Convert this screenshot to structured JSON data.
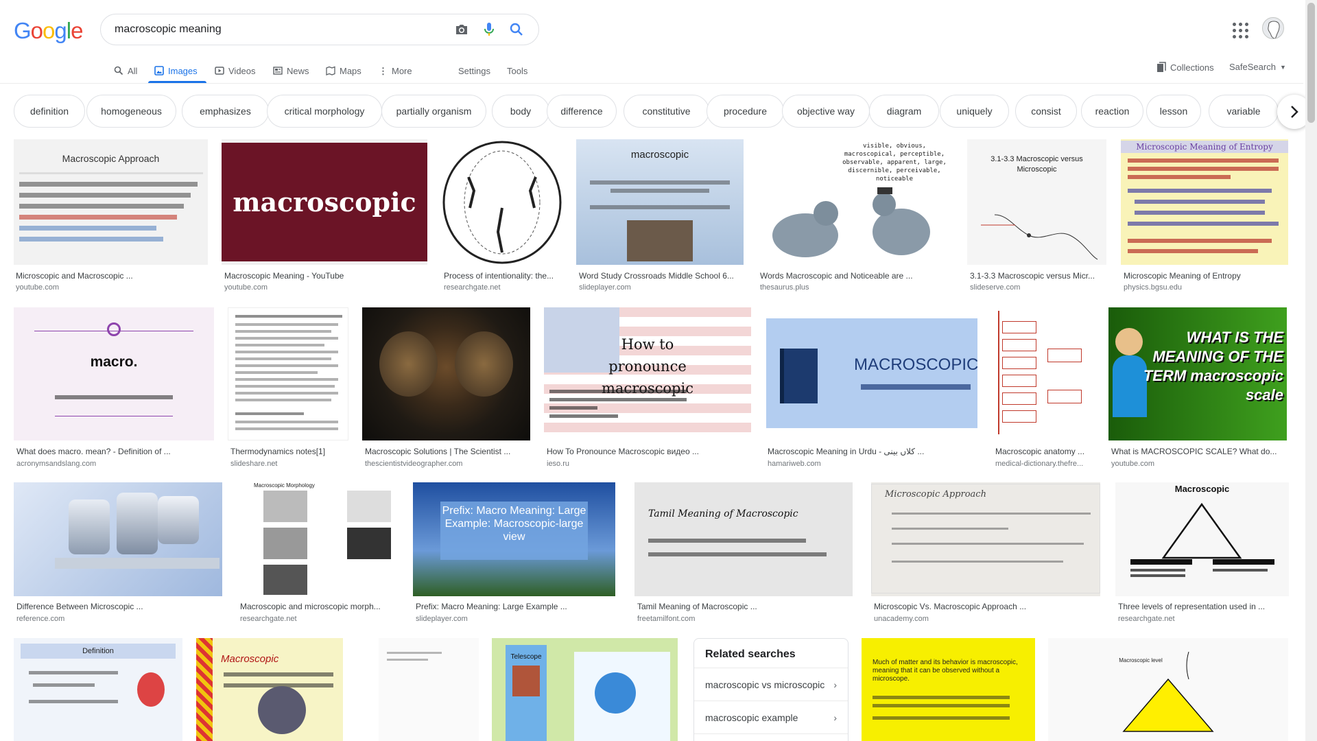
{
  "logo": {
    "letters": [
      "G",
      "o",
      "o",
      "g",
      "l",
      "e"
    ],
    "colors": [
      "#4285f4",
      "#ea4335",
      "#fbbc05",
      "#4285f4",
      "#34a853",
      "#ea4335"
    ]
  },
  "search": {
    "query": "macroscopic meaning",
    "icons": [
      "camera-icon",
      "microphone-icon",
      "search-icon"
    ]
  },
  "nav": {
    "tabs": [
      "All",
      "Images",
      "Videos",
      "News",
      "Maps",
      "More"
    ],
    "settings": "Settings",
    "tools": "Tools",
    "collections": "Collections",
    "safesearch": "SafeSearch"
  },
  "chips": [
    "definition",
    "homogeneous",
    "emphasizes",
    "critical morphology",
    "partially organism",
    "body",
    "difference",
    "constitutive",
    "procedure",
    "objective way",
    "diagram",
    "uniquely",
    "consist",
    "reaction",
    "lesson",
    "variable"
  ],
  "results": [
    {
      "title": "Microscopic and Macroscopic ...",
      "source": "youtube.com",
      "thumb_text": "Macroscopic Approach"
    },
    {
      "title": "Macroscopic Meaning - YouTube",
      "source": "youtube.com",
      "thumb_text": "macroscopic"
    },
    {
      "title": "Process of intentionality: the...",
      "source": "researchgate.net",
      "thumb_text": ""
    },
    {
      "title": "Word Study Crossroads Middle School 6...",
      "source": "slideplayer.com",
      "thumb_text": "macroscopic"
    },
    {
      "title": "Words Macroscopic and Noticeable are ...",
      "source": "thesaurus.plus",
      "thumb_text": "visible, obvious, macroscopical, perceptible, observable, apparent, large, discernible, perceivable, noticeable"
    },
    {
      "title": "3.1-3.3 Macroscopic versus Micr...",
      "source": "slideserve.com",
      "thumb_text": "3.1-3.3 Macroscopic versus Microscopic"
    },
    {
      "title": "Microscopic Meaning of Entropy",
      "source": "physics.bgsu.edu",
      "thumb_text": "Microscopic Meaning of Entropy"
    },
    {
      "title": "What does macro. mean? - Definition of ...",
      "source": "acronymsandslang.com",
      "thumb_text": "macro."
    },
    {
      "title": "Thermodynamics notes[1]",
      "source": "slideshare.net",
      "thumb_text": ""
    },
    {
      "title": "Macroscopic Solutions | The Scientist ...",
      "source": "thescientistvideographer.com",
      "thumb_text": ""
    },
    {
      "title": "How To Pronounce Macroscopic видео ...",
      "source": "ieso.ru",
      "thumb_text": "How to pronounce macroscopic"
    },
    {
      "title": "Macroscopic Meaning in Urdu - کلاں بینی ...",
      "source": "hamariweb.com",
      "thumb_text": "MACROSCOPIC"
    },
    {
      "title": "Macroscopic anatomy ...",
      "source": "medical-dictionary.thefre...",
      "thumb_text": ""
    },
    {
      "title": "What is MACROSCOPIC SCALE? What do...",
      "source": "youtube.com",
      "thumb_text": "WHAT IS THE MEANING OF THE TERM macroscopic scale"
    },
    {
      "title": "Difference Between Microscopic ...",
      "source": "reference.com",
      "thumb_text": ""
    },
    {
      "title": "Macroscopic and microscopic morph...",
      "source": "researchgate.net",
      "thumb_text": "Macroscopic Morphology"
    },
    {
      "title": "Prefix: Macro Meaning: Large Example ...",
      "source": "slideplayer.com",
      "thumb_text": "Prefix: Macro Meaning: Large Example: Macroscopic-large view"
    },
    {
      "title": "Tamil Meaning of Macroscopic ...",
      "source": "freetamilfont.com",
      "thumb_text": "Tamil Meaning of Macroscopic"
    },
    {
      "title": "Microscopic Vs. Macroscopic Approach ...",
      "source": "unacademy.com",
      "thumb_text": "Microscopic Approach"
    },
    {
      "title": "Three levels of representation used in ...",
      "source": "researchgate.net",
      "thumb_text": "Macroscopic"
    }
  ],
  "bottom_thumbs": [
    "Definition",
    "Macroscopic",
    "",
    "Telescope",
    "Much of matter and its behavior is macroscopic, meaning that it can be observed without a microscope.",
    "Macroscopic level"
  ],
  "related": {
    "title": "Related searches",
    "items": [
      "macroscopic vs microscopic",
      "macroscopic example"
    ]
  }
}
